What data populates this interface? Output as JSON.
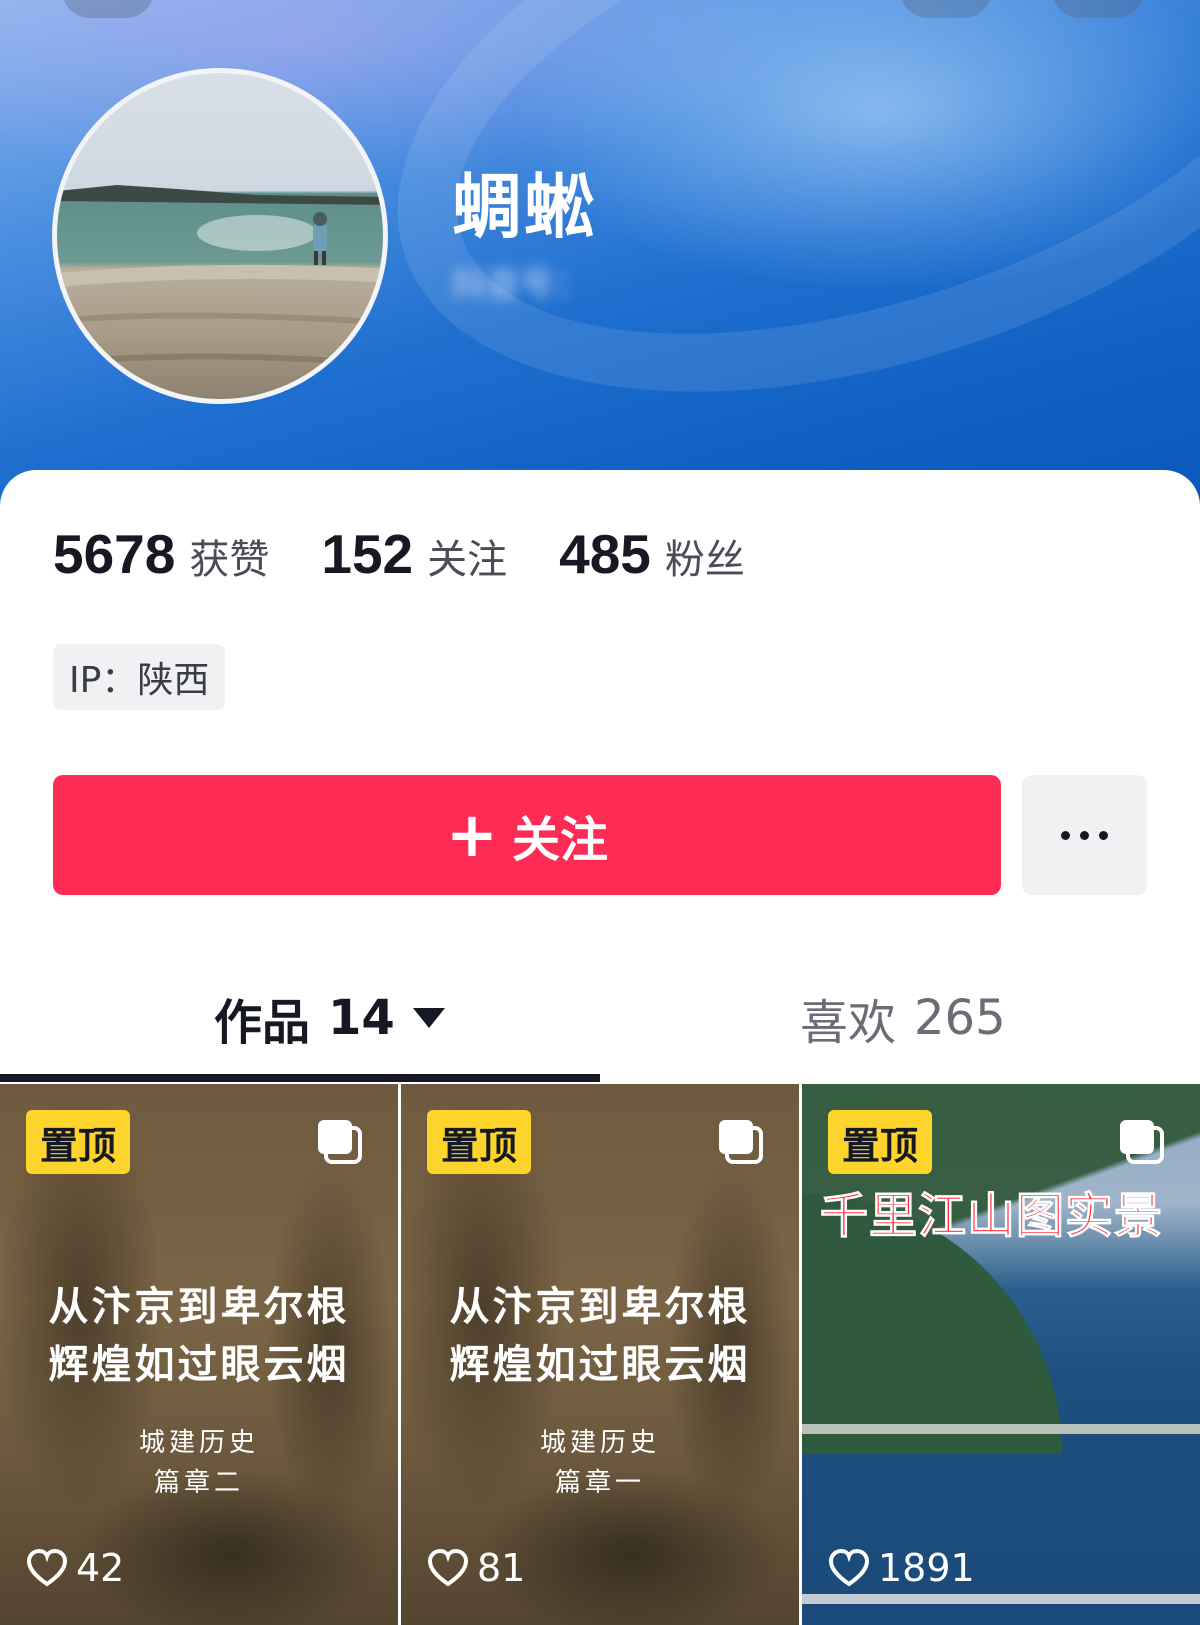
{
  "profile": {
    "nickname": "蜩蜙",
    "douyin_id": "抖音号：",
    "ip_label": "IP：陕西"
  },
  "stats": [
    {
      "value": "5678",
      "label": "获赞"
    },
    {
      "value": "152",
      "label": "关注"
    },
    {
      "value": "485",
      "label": "粉丝"
    }
  ],
  "actions": {
    "follow_label": "关注",
    "follow_plus": "+",
    "follow_color": "#fe2c55"
  },
  "tabs": {
    "works_label": "作品",
    "works_count": "14",
    "likes_label": "喜欢",
    "likes_count": "265"
  },
  "posts": [
    {
      "pin_label": "置顶",
      "title_line1": "从汴京到卑尔根",
      "title_line2": "辉煌如过眼云烟",
      "subtitle_line1": "城建历史",
      "subtitle_line2": "篇章二",
      "likes": "42"
    },
    {
      "pin_label": "置顶",
      "title_line1": "从汴京到卑尔根",
      "title_line2": "辉煌如过眼云烟",
      "subtitle_line1": "城建历史",
      "subtitle_line2": "篇章一",
      "likes": "81"
    },
    {
      "pin_label": "置顶",
      "title_line1": "千里江山图实景",
      "likes": "1891"
    }
  ],
  "icons": {
    "back": "back-icon",
    "search": "search-icon",
    "menu": "menu-icon",
    "more": "more-dots-icon",
    "multi_image": "multi-image-icon",
    "heart": "heart-icon",
    "dropdown": "caret-down-icon"
  }
}
